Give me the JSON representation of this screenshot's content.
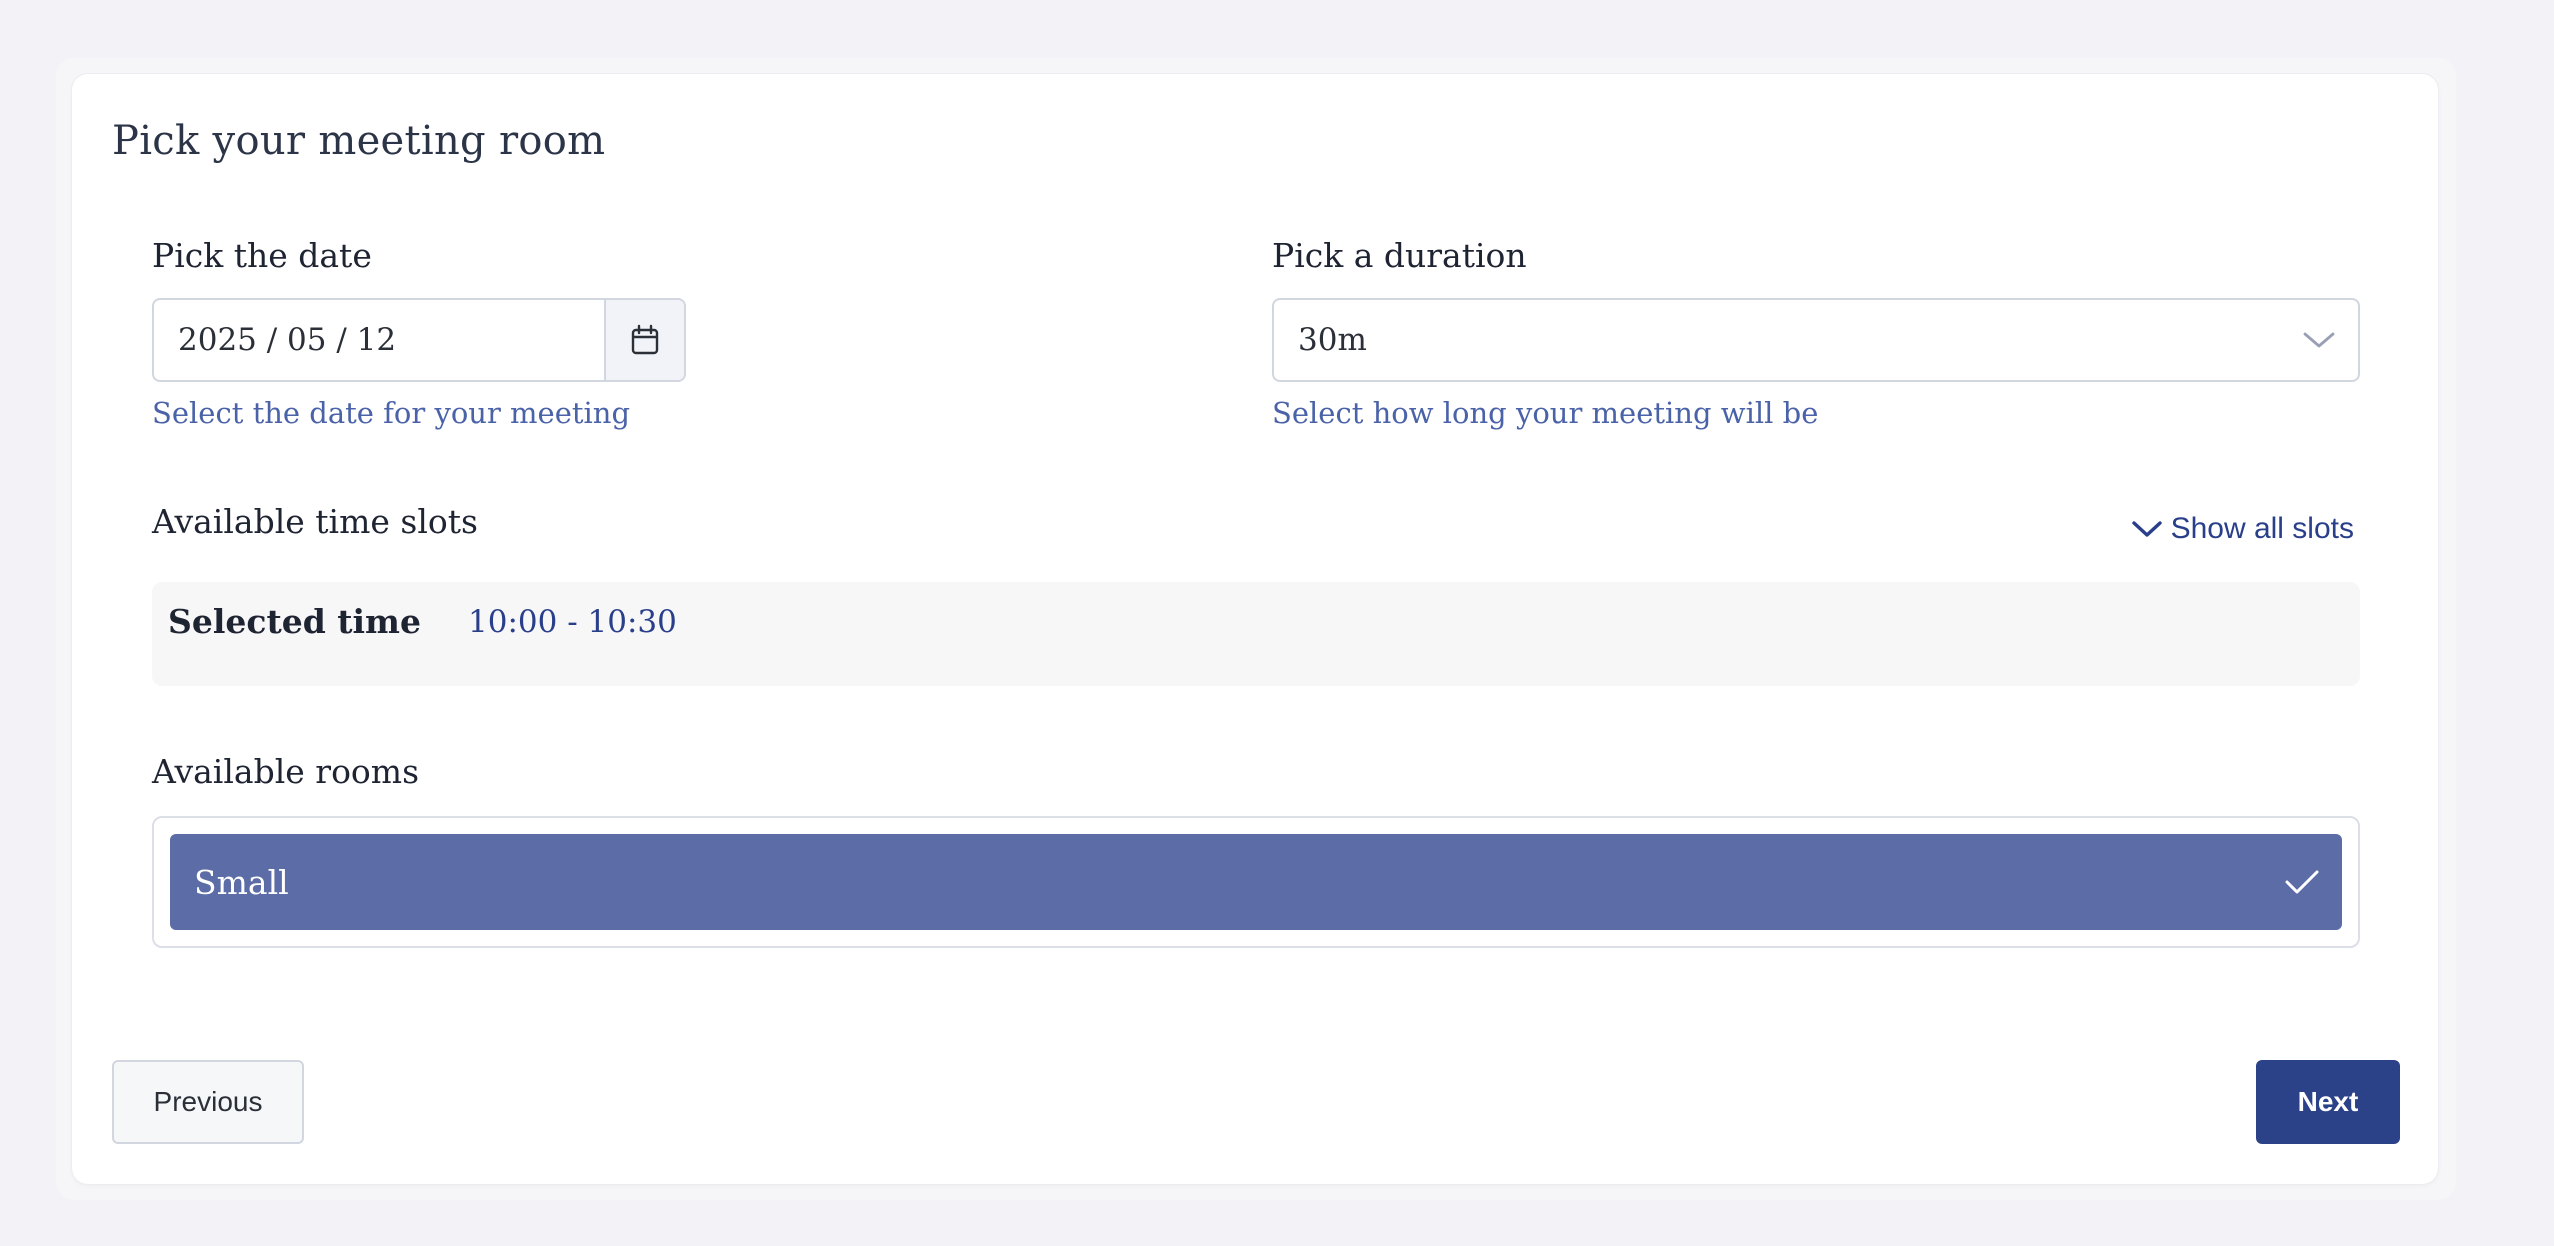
{
  "page": {
    "title": "Pick your meeting room"
  },
  "date": {
    "label": "Pick the date",
    "value": "2025 / 05 / 12",
    "helper": "Select the date for your meeting",
    "icon": "calendar-icon"
  },
  "duration": {
    "label": "Pick a duration",
    "value": "30m",
    "helper": "Select how long your meeting will be",
    "icon": "chevron-down-icon"
  },
  "time_slots": {
    "label": "Available time slots",
    "show_all_label": "Show all slots",
    "selected_label": "Selected time",
    "selected_value": "10:00 - 10:30"
  },
  "rooms": {
    "label": "Available rooms",
    "items": [
      {
        "label": "Small",
        "selected": true
      }
    ]
  },
  "actions": {
    "previous_label": "Previous",
    "next_label": "Next"
  },
  "colors": {
    "accent": "#2b4289",
    "selected_room": "#5b6ca7",
    "helper_text": "#4a62a8",
    "background": "#f3f2f6"
  }
}
